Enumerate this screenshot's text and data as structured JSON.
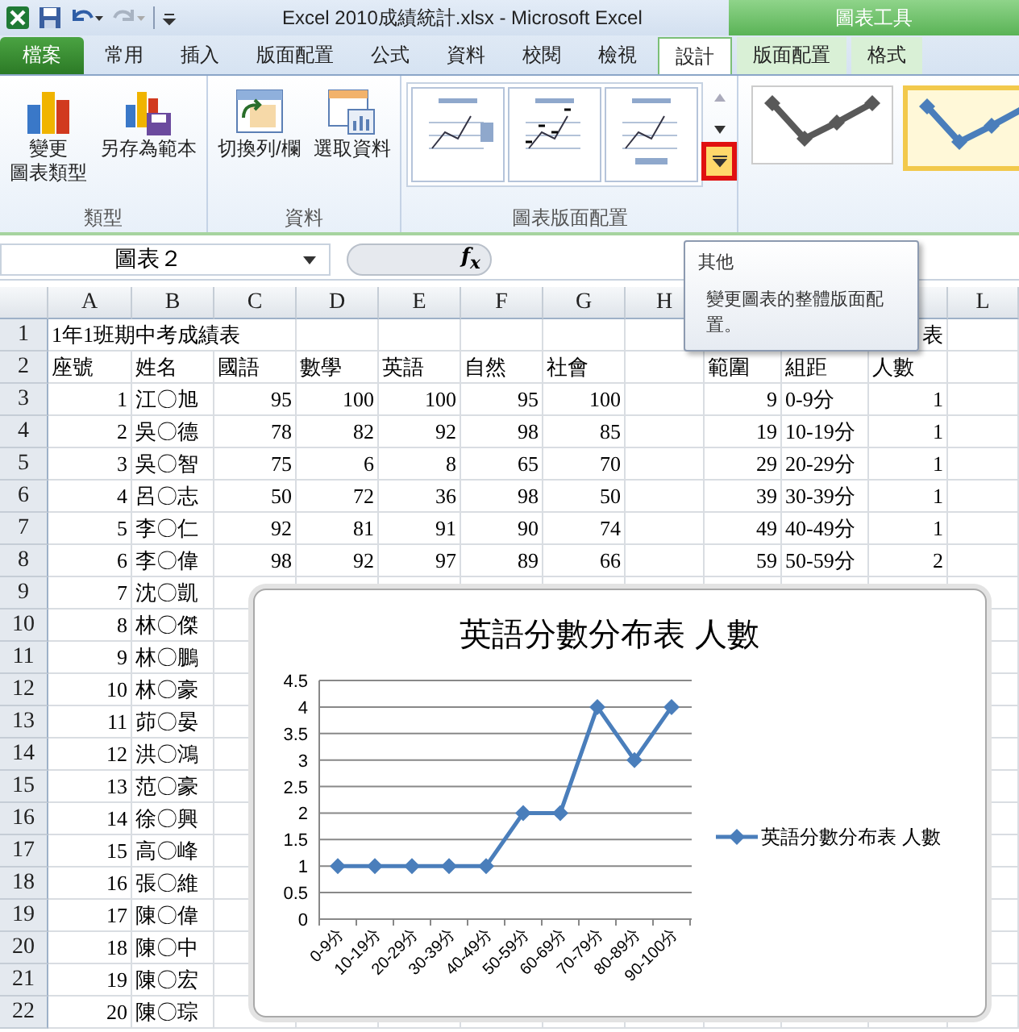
{
  "window": {
    "title": "Excel 2010成績統計.xlsx - Microsoft Excel",
    "context_group": "圖表工具"
  },
  "tabs": [
    {
      "label": "檔案",
      "kind": "file",
      "selected": false
    },
    {
      "label": "常用",
      "kind": "normal",
      "selected": false
    },
    {
      "label": "插入",
      "kind": "normal",
      "selected": false
    },
    {
      "label": "版面配置",
      "kind": "normal",
      "selected": false
    },
    {
      "label": "公式",
      "kind": "normal",
      "selected": false
    },
    {
      "label": "資料",
      "kind": "normal",
      "selected": false
    },
    {
      "label": "校閱",
      "kind": "normal",
      "selected": false
    },
    {
      "label": "檢視",
      "kind": "normal",
      "selected": false
    },
    {
      "label": "設計",
      "kind": "context",
      "selected": true
    },
    {
      "label": "版面配置",
      "kind": "context",
      "selected": false
    },
    {
      "label": "格式",
      "kind": "context",
      "selected": false
    }
  ],
  "ribbon": {
    "groups": [
      {
        "label": "類型",
        "buttons": [
          {
            "lines": [
              "變更",
              "圖表類型"
            ],
            "kind": "chart"
          },
          {
            "lines": [
              "另存為範本"
            ],
            "kind": "template"
          }
        ]
      },
      {
        "label": "資料",
        "buttons": [
          {
            "lines": [
              "切換列/欄"
            ],
            "kind": "switch"
          },
          {
            "lines": [
              "選取資料"
            ],
            "kind": "select"
          }
        ]
      }
    ],
    "layouts": {
      "label": "圖表版面配置",
      "items": [
        {
          "kind": "legend-right"
        },
        {
          "kind": "labels"
        },
        {
          "kind": "legend-bottom"
        }
      ],
      "more_highlighted": true
    },
    "styles": [
      {
        "color": "#595959",
        "selected": false
      },
      {
        "color": "#4a7ebb",
        "selected": true
      }
    ]
  },
  "formula_bar": {
    "name_box": "圖表２",
    "fx": "f$_{x}$"
  },
  "tooltip": {
    "title": "其他",
    "text": "變更圖表的整體版面配置。"
  },
  "sheet": {
    "columns": [
      {
        "label": "A"
      },
      {
        "label": "B"
      },
      {
        "label": "C"
      },
      {
        "label": "D"
      },
      {
        "label": "E"
      },
      {
        "label": "F"
      },
      {
        "label": "G"
      },
      {
        "label": "H"
      },
      {},
      {},
      {},
      {
        "label": "L"
      }
    ],
    "rows": [
      {
        "n": "1",
        "cells": [
          {
            "v": "1年1班期中考成績表"
          },
          null,
          null,
          null,
          null,
          null,
          null,
          null,
          null,
          null,
          {
            "v": "表",
            "num": true
          },
          null
        ]
      },
      {
        "n": "2",
        "cells": [
          {
            "v": "座號"
          },
          {
            "v": "姓名"
          },
          {
            "v": "國語"
          },
          {
            "v": "數學"
          },
          {
            "v": "英語"
          },
          {
            "v": "自然"
          },
          {
            "v": "社會"
          },
          null,
          {
            "v": "範圍"
          },
          {
            "v": "組距"
          },
          {
            "v": "人數"
          },
          null
        ]
      },
      {
        "n": "3",
        "cells": [
          {
            "v": "1",
            "num": true
          },
          {
            "v": "江〇旭"
          },
          {
            "v": "95",
            "num": true
          },
          {
            "v": "100",
            "num": true
          },
          {
            "v": "100",
            "num": true
          },
          {
            "v": "95",
            "num": true
          },
          {
            "v": "100",
            "num": true
          },
          null,
          {
            "v": "9",
            "num": true
          },
          {
            "v": "0-9分"
          },
          {
            "v": "1",
            "num": true
          },
          null
        ]
      },
      {
        "n": "4",
        "cells": [
          {
            "v": "2",
            "num": true
          },
          {
            "v": "吳〇德"
          },
          {
            "v": "78",
            "num": true
          },
          {
            "v": "82",
            "num": true
          },
          {
            "v": "92",
            "num": true
          },
          {
            "v": "98",
            "num": true
          },
          {
            "v": "85",
            "num": true
          },
          null,
          {
            "v": "19",
            "num": true
          },
          {
            "v": "10-19分"
          },
          {
            "v": "1",
            "num": true
          },
          null
        ]
      },
      {
        "n": "5",
        "cells": [
          {
            "v": "3",
            "num": true
          },
          {
            "v": "吳〇智"
          },
          {
            "v": "75",
            "num": true
          },
          {
            "v": "6",
            "num": true
          },
          {
            "v": "8",
            "num": true
          },
          {
            "v": "65",
            "num": true
          },
          {
            "v": "70",
            "num": true
          },
          null,
          {
            "v": "29",
            "num": true
          },
          {
            "v": "20-29分"
          },
          {
            "v": "1",
            "num": true
          },
          null
        ]
      },
      {
        "n": "6",
        "cells": [
          {
            "v": "4",
            "num": true
          },
          {
            "v": "呂〇志"
          },
          {
            "v": "50",
            "num": true
          },
          {
            "v": "72",
            "num": true
          },
          {
            "v": "36",
            "num": true
          },
          {
            "v": "98",
            "num": true
          },
          {
            "v": "50",
            "num": true
          },
          null,
          {
            "v": "39",
            "num": true
          },
          {
            "v": "30-39分"
          },
          {
            "v": "1",
            "num": true
          },
          null
        ]
      },
      {
        "n": "7",
        "cells": [
          {
            "v": "5",
            "num": true
          },
          {
            "v": "李〇仁"
          },
          {
            "v": "92",
            "num": true
          },
          {
            "v": "81",
            "num": true
          },
          {
            "v": "91",
            "num": true
          },
          {
            "v": "90",
            "num": true
          },
          {
            "v": "74",
            "num": true
          },
          null,
          {
            "v": "49",
            "num": true
          },
          {
            "v": "40-49分"
          },
          {
            "v": "1",
            "num": true
          },
          null
        ]
      },
      {
        "n": "8",
        "cells": [
          {
            "v": "6",
            "num": true
          },
          {
            "v": "李〇偉"
          },
          {
            "v": "98",
            "num": true
          },
          {
            "v": "92",
            "num": true
          },
          {
            "v": "97",
            "num": true
          },
          {
            "v": "89",
            "num": true
          },
          {
            "v": "66",
            "num": true
          },
          null,
          {
            "v": "59",
            "num": true
          },
          {
            "v": "50-59分"
          },
          {
            "v": "2",
            "num": true
          },
          null
        ]
      },
      {
        "n": "9",
        "cells": [
          {
            "v": "7",
            "num": true
          },
          {
            "v": "沈〇凱"
          }
        ]
      },
      {
        "n": "10",
        "cells": [
          {
            "v": "8",
            "num": true
          },
          {
            "v": "林〇傑"
          }
        ]
      },
      {
        "n": "11",
        "cells": [
          {
            "v": "9",
            "num": true
          },
          {
            "v": "林〇鵬"
          }
        ]
      },
      {
        "n": "12",
        "cells": [
          {
            "v": "10",
            "num": true
          },
          {
            "v": "林〇豪"
          }
        ]
      },
      {
        "n": "13",
        "cells": [
          {
            "v": "11",
            "num": true
          },
          {
            "v": "茆〇晏"
          }
        ]
      },
      {
        "n": "14",
        "cells": [
          {
            "v": "12",
            "num": true
          },
          {
            "v": "洪〇鴻"
          }
        ]
      },
      {
        "n": "15",
        "cells": [
          {
            "v": "13",
            "num": true
          },
          {
            "v": "范〇豪"
          }
        ]
      },
      {
        "n": "16",
        "cells": [
          {
            "v": "14",
            "num": true
          },
          {
            "v": "徐〇興"
          }
        ]
      },
      {
        "n": "17",
        "cells": [
          {
            "v": "15",
            "num": true
          },
          {
            "v": "高〇峰"
          }
        ]
      },
      {
        "n": "18",
        "cells": [
          {
            "v": "16",
            "num": true
          },
          {
            "v": "張〇維"
          }
        ]
      },
      {
        "n": "19",
        "cells": [
          {
            "v": "17",
            "num": true
          },
          {
            "v": "陳〇偉"
          }
        ]
      },
      {
        "n": "20",
        "cells": [
          {
            "v": "18",
            "num": true
          },
          {
            "v": "陳〇中"
          }
        ]
      },
      {
        "n": "21",
        "cells": [
          {
            "v": "19",
            "num": true
          },
          {
            "v": "陳〇宏"
          }
        ]
      },
      {
        "n": "22",
        "cells": [
          {
            "v": "20",
            "num": true
          },
          {
            "v": "陳〇琮"
          }
        ]
      }
    ]
  },
  "chart": {
    "chart_data": {
      "type": "line",
      "title": "英語分數分布表 人數",
      "categories": [
        "0-9分",
        "10-19分",
        "20-29分",
        "30-39分",
        "40-49分",
        "50-59分",
        "60-69分",
        "70-79分",
        "80-89分",
        "90-100分"
      ],
      "grid": true,
      "series": [
        {
          "name": "英語分數分布表 人數",
          "color": "#4a7ebb",
          "marker": "diamond",
          "values": [
            1,
            1,
            1,
            1,
            1,
            2,
            2,
            4,
            3,
            4
          ]
        }
      ],
      "ylim": [
        0,
        4.5
      ],
      "yticks": [
        0,
        0.5,
        1,
        1.5,
        2,
        2.5,
        3,
        3.5,
        4,
        4.5
      ]
    }
  }
}
